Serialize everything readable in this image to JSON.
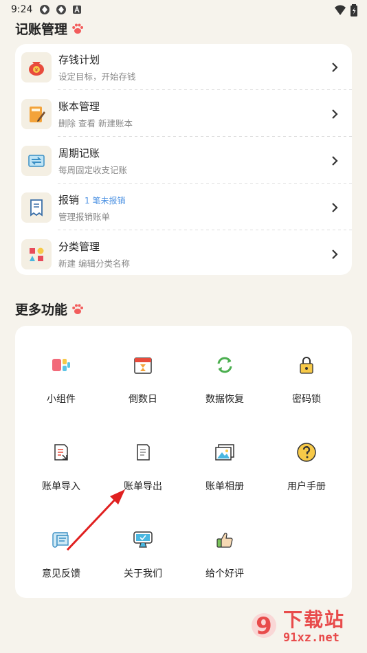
{
  "status": {
    "time": "9:24"
  },
  "bookkeeping": {
    "title": "记账管理",
    "items": [
      {
        "title": "存钱计划",
        "tag": "",
        "subtitle": "设定目标，开始存钱",
        "icon": "money-bag-icon"
      },
      {
        "title": "账本管理",
        "tag": "",
        "subtitle": "删除 查看 新建账本",
        "icon": "notebook-icon"
      },
      {
        "title": "周期记账",
        "tag": "",
        "subtitle": "每周固定收支记账",
        "icon": "cycle-calendar-icon"
      },
      {
        "title": "报销",
        "tag": "1 笔未报销",
        "subtitle": "管理报销账单",
        "icon": "receipt-icon"
      },
      {
        "title": "分类管理",
        "tag": "",
        "subtitle": "新建 编辑分类名称",
        "icon": "shapes-icon"
      }
    ]
  },
  "more": {
    "title": "更多功能",
    "items": [
      {
        "label": "小组件",
        "icon": "widget-icon"
      },
      {
        "label": "倒数日",
        "icon": "calendar-hourglass-icon"
      },
      {
        "label": "数据恢复",
        "icon": "sync-icon"
      },
      {
        "label": "密码锁",
        "icon": "lock-icon"
      },
      {
        "label": "账单导入",
        "icon": "import-document-icon"
      },
      {
        "label": "账单导出",
        "icon": "export-document-icon"
      },
      {
        "label": "账单相册",
        "icon": "photo-album-icon"
      },
      {
        "label": "用户手册",
        "icon": "question-icon"
      },
      {
        "label": "意见反馈",
        "icon": "feedback-scroll-icon"
      },
      {
        "label": "关于我们",
        "icon": "monitor-icon"
      },
      {
        "label": "给个好评",
        "icon": "thumbs-up-icon"
      }
    ]
  },
  "watermark": {
    "text_main": "下载站",
    "text_domain": "91xz.net"
  },
  "colors": {
    "background": "#f6f3ec",
    "card": "#ffffff",
    "accent_paw": "#f25c5c",
    "tag_blue": "#4a90e2",
    "arrow_red": "#e02020"
  }
}
